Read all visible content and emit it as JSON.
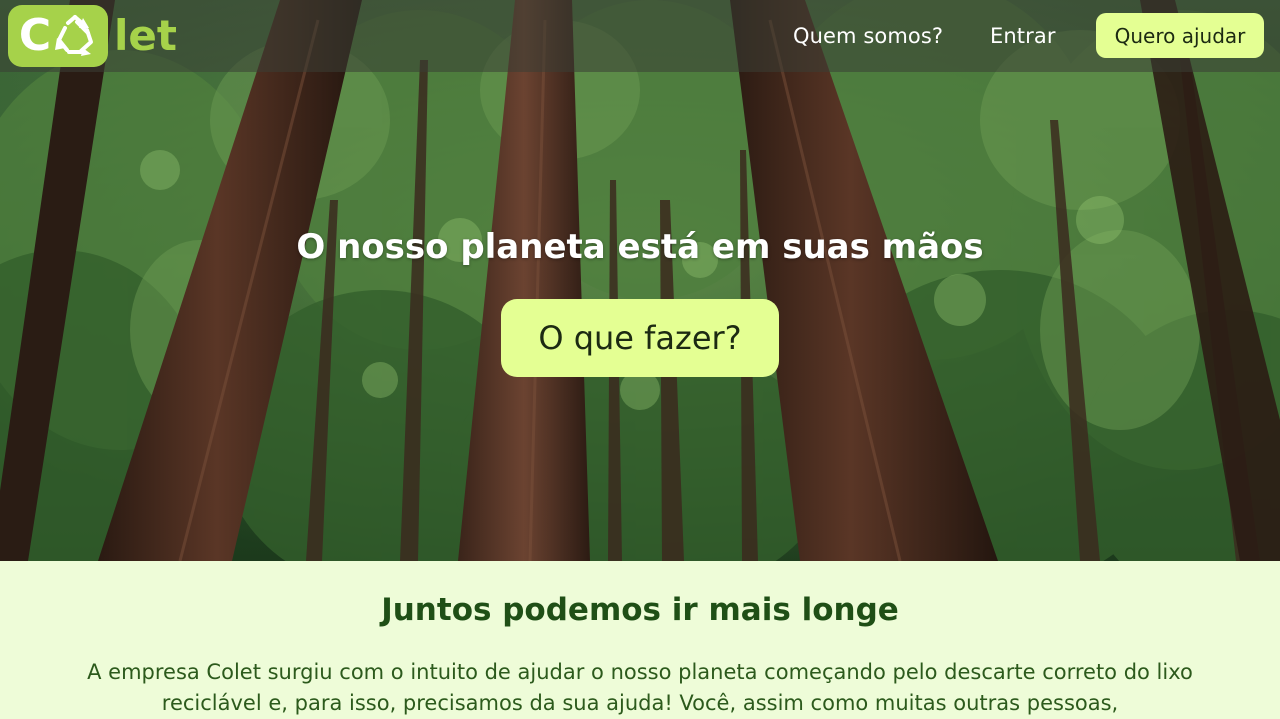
{
  "brand": {
    "logo_letter": "C",
    "logo_rest": "let",
    "accent_color": "#a6d24a",
    "cta_color": "#e4ff93"
  },
  "nav": {
    "about_label": "Quem somos?",
    "login_label": "Entrar",
    "cta_label": "Quero ajudar"
  },
  "hero": {
    "title": "O nosso planeta está em suas mãos",
    "button_label": "O que fazer?"
  },
  "about": {
    "title": "Juntos podemos ir mais longe",
    "text": "A empresa Colet surgiu com o intuito de ajudar o nosso planeta começando pelo descarte correto do lixo reciclável e, para isso, precisamos da sua ajuda! Você, assim como muitas outras pessoas,"
  }
}
